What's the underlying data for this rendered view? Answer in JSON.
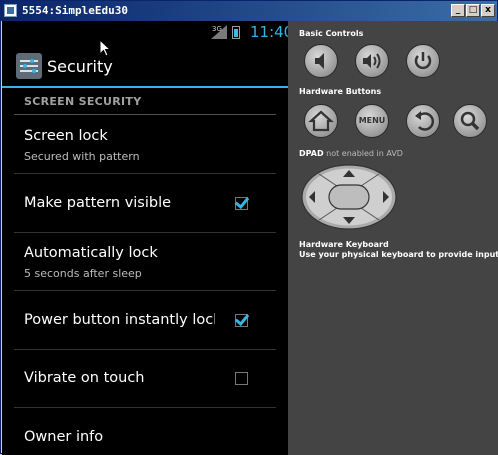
{
  "window": {
    "title": "5554:SimpleEdu30",
    "min_label": "_",
    "max_label": "□",
    "close_label": "x"
  },
  "statusbar": {
    "signal_label": "3G",
    "time": "11:40",
    "battery_icon": "battery-charging-icon"
  },
  "actionbar": {
    "title": "Security",
    "icon": "security-settings-icon"
  },
  "section": {
    "header": "SCREEN SECURITY"
  },
  "prefs": [
    {
      "title": "Screen lock",
      "summary": "Secured with pattern"
    },
    {
      "title": "Make pattern visible",
      "checked": true
    },
    {
      "title": "Automatically lock",
      "summary": "5 seconds after sleep"
    },
    {
      "title": "Power button instantly lock",
      "checked": true
    },
    {
      "title": "Vibrate on touch",
      "checked": false
    },
    {
      "title": "Owner info"
    }
  ],
  "panel": {
    "basic_controls": "Basic Controls",
    "hardware_buttons": "Hardware Buttons",
    "dpad_label": "DPAD",
    "dpad_note": " not enabled in AVD",
    "keyboard_title": "Hardware Keyboard",
    "keyboard_note": "Use your physical keyboard to provide input",
    "menu_label": "MENU"
  },
  "colors": {
    "accent": "#33b5e5",
    "panel_bg": "#444444",
    "screen_bg": "#000000"
  }
}
